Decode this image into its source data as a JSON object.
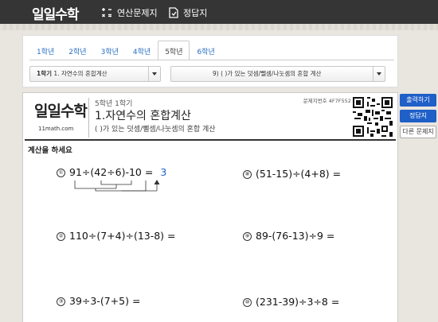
{
  "app": {
    "logo": "일일수학",
    "nav": [
      {
        "label": "연산문제지",
        "icon": "calculator-icon"
      },
      {
        "label": "정답지",
        "icon": "answer-sheet-icon"
      }
    ]
  },
  "grade_tabs": [
    "1학년",
    "2학년",
    "3학년",
    "4학년",
    "5학년",
    "6학년"
  ],
  "active_tab": "5학년",
  "selects": {
    "unit_prefix": "1학기",
    "unit_value": " 1. 자연수의 혼합계산",
    "topic_value": "9) ( )가 있는 덧셈/뺄셈/나눗셈의 혼합 계산"
  },
  "sheet": {
    "logo": "일일수학",
    "url": "11math.com",
    "grade": "5학년 1학기",
    "title": "1.자연수의 혼합계산",
    "subtitle": "( )가 있는 덧셈/뺄셈/나눗셈의 혼합 계산",
    "sheet_no": "문제지번호 4F7F552E",
    "instruction": "계산을 하세요"
  },
  "problems": [
    {
      "no": "①",
      "expr": "91÷(42÷6)-10 =",
      "answer": "3"
    },
    {
      "no": "⑧",
      "expr": "(51-15)÷(4+8) =",
      "answer": ""
    },
    {
      "no": "②",
      "expr": "110÷(7+4)÷(13-8) =",
      "answer": ""
    },
    {
      "no": "⑨",
      "expr": "89-(76-13)÷9 =",
      "answer": ""
    },
    {
      "no": "③",
      "expr": "39÷3-(7+5) =",
      "answer": ""
    },
    {
      "no": "⑩",
      "expr": "(231-39)÷3÷8 =",
      "answer": ""
    }
  ],
  "side_buttons": [
    "출력하기",
    "정답지",
    "다른 문제지"
  ],
  "colors": {
    "accent": "#1f5fc8",
    "topbar": "#353535"
  }
}
